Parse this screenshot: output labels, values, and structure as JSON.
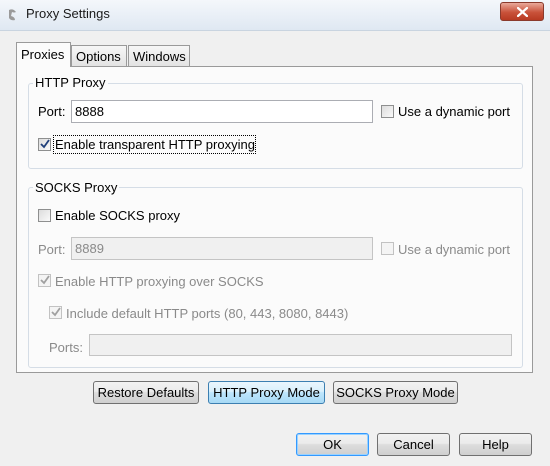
{
  "window": {
    "title": "Proxy Settings"
  },
  "tabs": [
    {
      "label": "Proxies",
      "active": true
    },
    {
      "label": "Options",
      "active": false
    },
    {
      "label": "Windows",
      "active": false
    }
  ],
  "http_proxy": {
    "group_label": "HTTP Proxy",
    "port_label": "Port:",
    "port_value": "8888",
    "dynamic_port_label": "Use a dynamic port",
    "dynamic_port_checked": false,
    "transparent_label": "Enable transparent HTTP proxying",
    "transparent_checked": true
  },
  "socks_proxy": {
    "group_label": "SOCKS Proxy",
    "enable_label": "Enable SOCKS proxy",
    "enable_checked": false,
    "port_label": "Port:",
    "port_value": "8889",
    "dynamic_port_label": "Use a dynamic port",
    "http_over_socks_label": "Enable HTTP proxying over SOCKS",
    "http_over_socks_checked": true,
    "include_ports_label": "Include default HTTP ports (80, 443, 8080, 8443)",
    "include_ports_checked": true,
    "ports_label": "Ports:",
    "ports_value": ""
  },
  "mode_buttons": {
    "restore_defaults": "Restore Defaults",
    "http_proxy_mode": "HTTP Proxy Mode",
    "socks_proxy_mode": "SOCKS Proxy Mode"
  },
  "dialog_buttons": {
    "ok": "OK",
    "cancel": "Cancel",
    "help": "Help"
  }
}
